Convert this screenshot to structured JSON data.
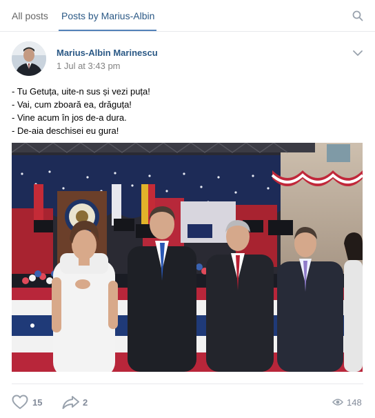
{
  "tabs": [
    {
      "label": "All posts",
      "active": false
    },
    {
      "label": "Posts by Marius-Albin",
      "active": true
    }
  ],
  "post": {
    "author": "Marius-Albin Marinescu",
    "date": "1 Jul at 3:43 pm",
    "lines": [
      "- Tu Getuța, uite-n sus și vezi puța!",
      "- Vai, cum zboară ea, drăguța!",
      "- Vine acum în jos de-a dura.",
      "- De-aia deschisei eu gura!"
    ]
  },
  "actions": {
    "likes": "15",
    "shares": "2",
    "views": "148"
  },
  "colors": {
    "link": "#2a5885",
    "accent": "#5181b8",
    "muted": "#828a99",
    "divider": "#e7e8ec"
  },
  "icons": [
    "search-icon",
    "chevron-down-icon",
    "heart-icon",
    "share-arrow-icon",
    "eye-icon"
  ]
}
